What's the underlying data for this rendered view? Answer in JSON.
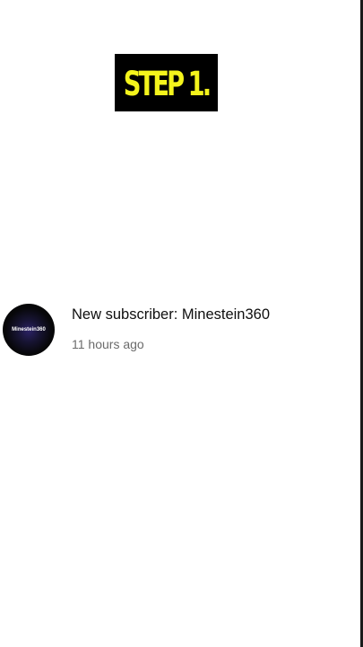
{
  "banner": {
    "text": "STEP 1.",
    "colors": {
      "background": "#000000",
      "text": "#f4f41c"
    }
  },
  "notification": {
    "avatar": {
      "label": "Minestein360",
      "icon": "channel-avatar"
    },
    "title": "New subscriber: Minestein360",
    "time": "11 hours ago"
  }
}
